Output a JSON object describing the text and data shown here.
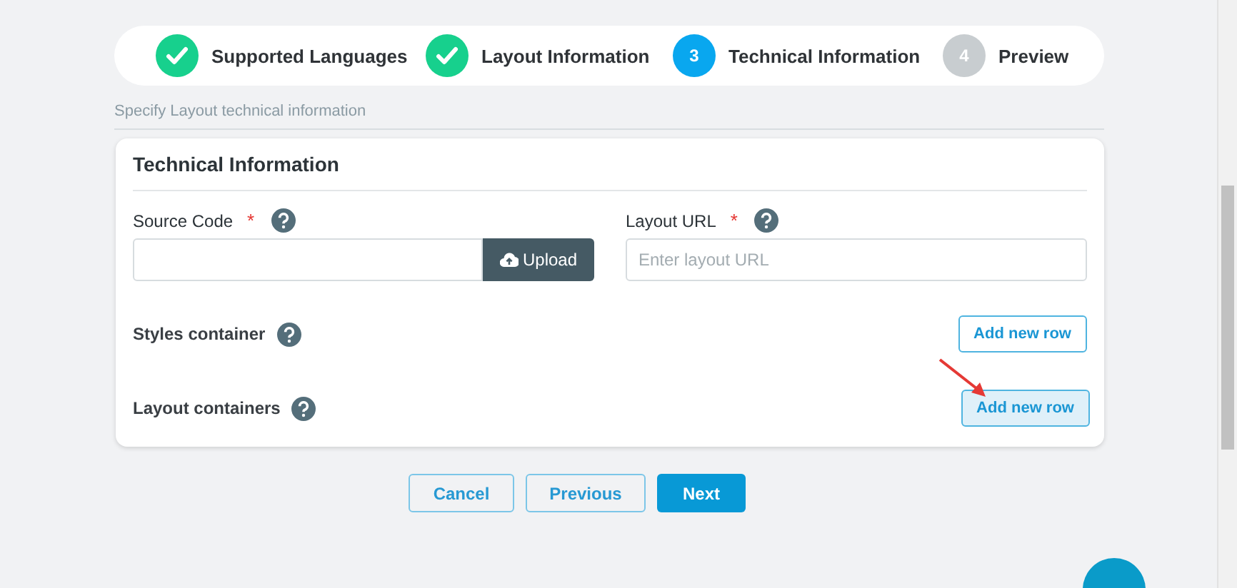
{
  "steps": [
    {
      "label": "Supported Languages",
      "kind": "done"
    },
    {
      "label": "Layout Information",
      "kind": "done"
    },
    {
      "number": "3",
      "label": "Technical Information",
      "kind": "current"
    },
    {
      "number": "4",
      "label": "Preview",
      "kind": "pending"
    }
  ],
  "subtitle": "Specify Layout technical information",
  "card": {
    "title": "Technical Information",
    "fields": [
      {
        "label": "Source Code",
        "required_mark": "*",
        "button": "Upload"
      },
      {
        "label": "Layout URL",
        "required_mark": "*",
        "placeholder": "Enter layout URL"
      }
    ],
    "rows": [
      {
        "label": "Styles container",
        "button": "Add new row",
        "hovered": false
      },
      {
        "label": "Layout containers",
        "button": "Add new row",
        "hovered": true
      }
    ]
  },
  "actions": [
    {
      "label": "Cancel",
      "kind": "secondary"
    },
    {
      "label": "Previous",
      "kind": "secondary"
    },
    {
      "label": "Next",
      "kind": "primary"
    }
  ]
}
